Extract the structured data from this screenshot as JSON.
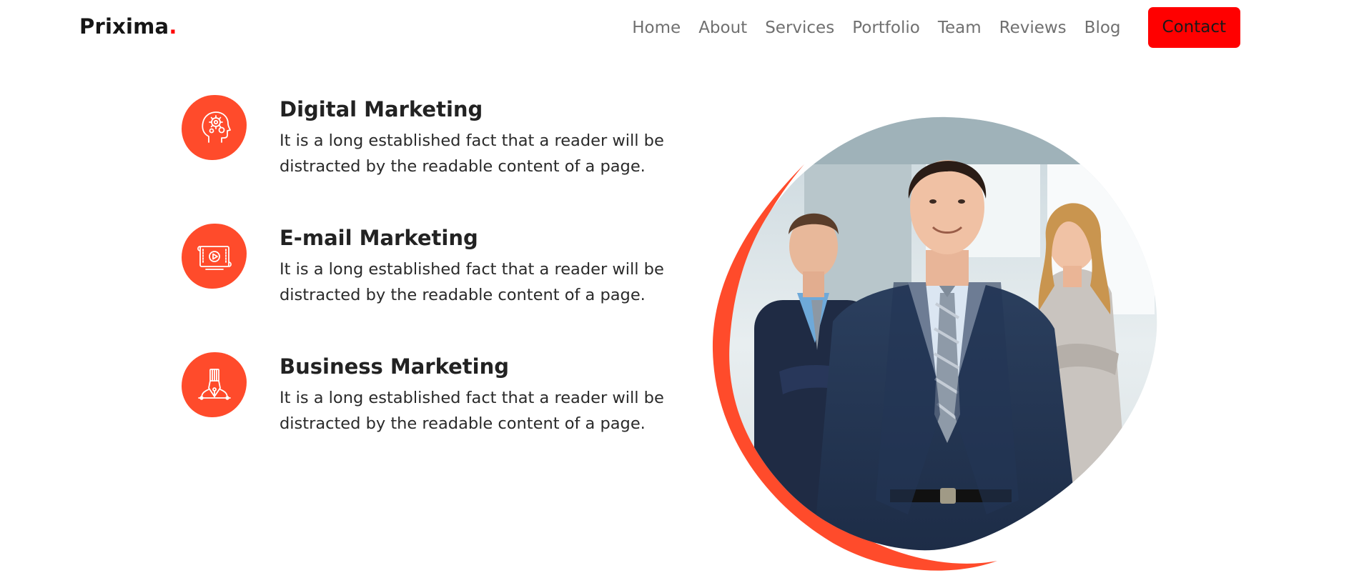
{
  "brand": {
    "name": "Prixima",
    "dot": "."
  },
  "nav": {
    "items": [
      {
        "label": "Home"
      },
      {
        "label": "About"
      },
      {
        "label": "Services"
      },
      {
        "label": "Portfolio"
      },
      {
        "label": "Team"
      },
      {
        "label": "Reviews"
      },
      {
        "label": "Blog"
      }
    ],
    "contact_label": "Contact"
  },
  "services": [
    {
      "title": "Digital Marketing",
      "text": "It is a long established fact that a reader will be distracted by the readable content of a page.",
      "icon": "head-gears-icon"
    },
    {
      "title": "E-mail Marketing",
      "text": "It is a long established fact that a reader will be distracted by the readable content of a page.",
      "icon": "video-scroll-icon"
    },
    {
      "title": "Business Marketing",
      "text": "It is a long established fact that a reader will be distracted by the readable content of a page.",
      "icon": "pen-tool-icon"
    }
  ],
  "colors": {
    "accent": "#ff4b2b",
    "contact_button": "#ff0000",
    "brand_dot": "#ff0000",
    "nav_text": "#707070"
  },
  "hero_image": {
    "description_icon": "business-team-photo"
  }
}
